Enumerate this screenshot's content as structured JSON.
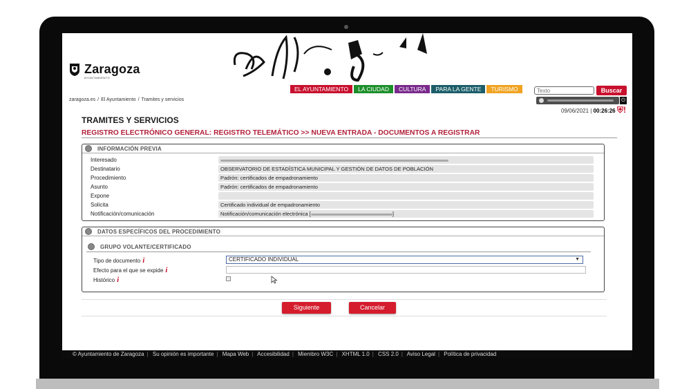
{
  "brand": {
    "name": "Zaragoza",
    "sub": "AYUNTAMIENTO"
  },
  "nav": [
    {
      "label": "EL AYUNTAMIENTO",
      "color": "#c8102e"
    },
    {
      "label": "LA CIUDAD",
      "color": "#1c8f2a"
    },
    {
      "label": "CULTURA",
      "color": "#7a2a8c"
    },
    {
      "label": "PARA LA GENTE",
      "color": "#1b5e69"
    },
    {
      "label": "TURISMO",
      "color": "#f0a321"
    }
  ],
  "search": {
    "placeholder": "Texto",
    "button": "Buscar"
  },
  "breadcrumb": [
    "zaragoza.es",
    "/",
    "El Ayuntamiento",
    "/",
    "Tramites y servicios"
  ],
  "session": {
    "date": "09/06/2021",
    "sep": "|",
    "time": "00:26:26"
  },
  "page": {
    "title": "TRAMITES Y SERVICIOS",
    "subtitle": "REGISTRO ELECTRÓNICO GENERAL: REGISTRO TELEMÁTICO >> NUEVA ENTRADA - DOCUMENTOS A REGISTRAR"
  },
  "info_previa": {
    "title": "INFORMACIÓN PREVIA",
    "rows": [
      {
        "label": "Interesado",
        "value": ""
      },
      {
        "label": "Destinatario",
        "value": "OBSERVATORIO DE ESTADÍSTICA MUNICIPAL Y GESTIÓN DE DATOS DE POBLACIÓN"
      },
      {
        "label": "Procedimiento",
        "value": "Padrón: certificados de empadronamiento"
      },
      {
        "label": "Asunto",
        "value": "Padrón: certificados de empadronamiento"
      },
      {
        "label": "Expone",
        "value": ""
      },
      {
        "label": "Solicita",
        "value": "Certificado individual de empadronamiento"
      },
      {
        "label": "Notificación/comunicación",
        "value": "Notificación/comunicación electrónica ["
      }
    ]
  },
  "datos_especificos": {
    "title": "DATOS ESPECÍFICOS DEL PROCEDIMIENTO",
    "group_title": "GRUPO VOLANTE/CERTIFICADO",
    "tipo_label": "Tipo de documento",
    "tipo_value": "CERTIFICADO INDIVIDUAL",
    "efecto_label": "Efecto para el que se expide",
    "historico_label": "Histórico",
    "info_mark": "i"
  },
  "actions": {
    "next": "Siguiente",
    "cancel": "Cancelar"
  },
  "footer": [
    "© Ayuntamiento de Zaragoza",
    "Su opinión es importante",
    "Mapa Web",
    "Accesibilidad",
    "Miembro W3C",
    "XHTML 1.0",
    "CSS 2.0",
    "Aviso Legal",
    "Política de privacidad"
  ]
}
